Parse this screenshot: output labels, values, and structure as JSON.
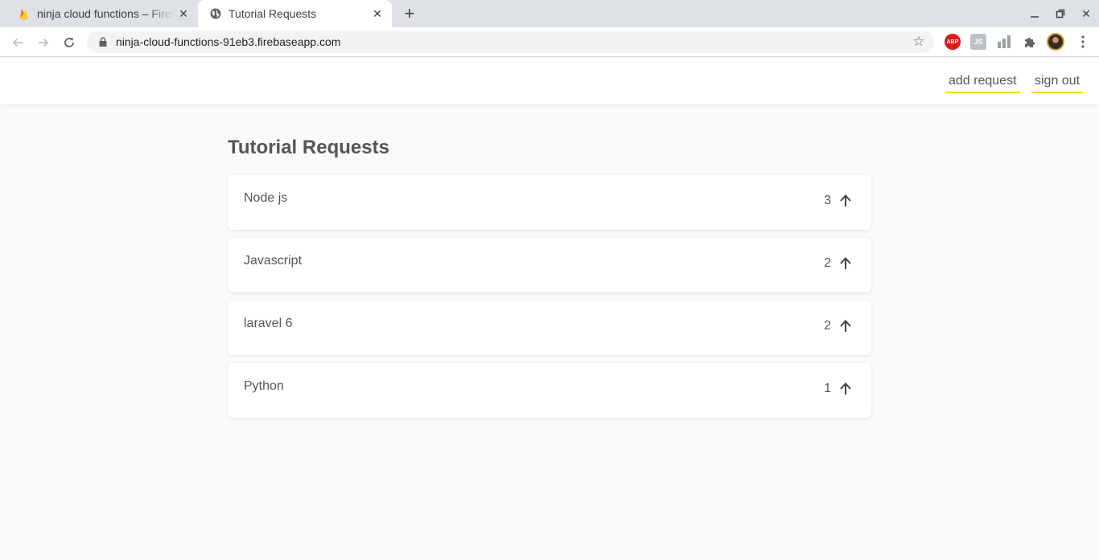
{
  "browser": {
    "tabs": [
      {
        "title": "ninja cloud functions – Firebase",
        "active": false,
        "icon": "firebase-icon"
      },
      {
        "title": "Tutorial Requests",
        "active": true,
        "icon": "globe-icon"
      }
    ],
    "url": "ninja-cloud-functions-91eb3.firebaseapp.com",
    "extensions": {
      "abp_label": "ABP",
      "js_label": "JS"
    }
  },
  "navbar": {
    "add_request_label": "add request",
    "sign_out_label": "sign out",
    "underline_color": "#f2e21a"
  },
  "main": {
    "title": "Tutorial Requests",
    "requests": [
      {
        "text": "Node js",
        "upvotes": "3"
      },
      {
        "text": "Javascript",
        "upvotes": "2"
      },
      {
        "text": "laravel 6",
        "upvotes": "2"
      },
      {
        "text": "Python",
        "upvotes": "1"
      }
    ]
  }
}
